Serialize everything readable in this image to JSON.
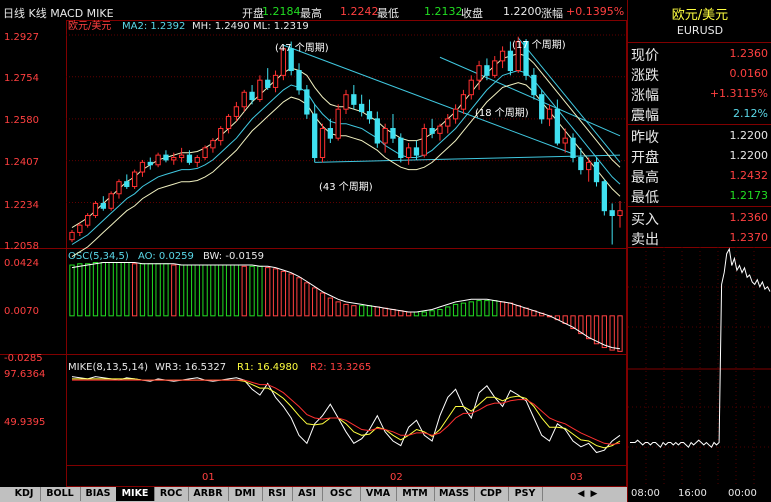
{
  "topbar": {
    "title": "日线 K线 MACD MIKE",
    "open_label": "开盘",
    "open_value": "1.2184",
    "high_label": "最高",
    "high_value": "1.2242",
    "low_label": "最低",
    "low_value": "1.2132",
    "close_label": "收盘",
    "close_value": "1.2200",
    "change_label": "涨幅",
    "change_value": "+0.1395%"
  },
  "main_pane": {
    "title": "欧元/美元",
    "ma2": "MA2: 1.2392",
    "mh": "MH: 1.2490",
    "ml": "ML: 1.2319",
    "y_ticks": [
      "1.2927",
      "1.2754",
      "1.2580",
      "1.2407",
      "1.2234",
      "1.2058"
    ],
    "annotations": [
      "(47 个周期)",
      "(17 个周期)",
      "(18 个周期)",
      "(43 个周期)"
    ]
  },
  "osc_pane": {
    "title": "OSC(5,34,5)",
    "ao": "AO: 0.0259",
    "bw": "BW: -0.0159",
    "y_ticks": [
      "0.0424",
      "0.0070",
      "-0.0285"
    ]
  },
  "mike_pane": {
    "title": "MIKE(8,13,5,14)",
    "wr3": "WR3: 16.5327",
    "r1": "R1: 16.4980",
    "r2": "R2: 13.3265",
    "y_ticks": [
      "97.6364",
      "49.9395"
    ]
  },
  "x_axis": {
    "labels": [
      "01",
      "02",
      "03"
    ]
  },
  "tabs": {
    "items": [
      "KDJ",
      "BOLL",
      "BIAS",
      "MIKE",
      "ROC",
      "ARBR",
      "DMI",
      "RSI",
      "ASI",
      "OSC",
      "VMA",
      "MTM",
      "MASS",
      "CDP",
      "PSY"
    ],
    "active": "MIKE"
  },
  "panel": {
    "name": "欧元/美元",
    "code": "EURUSD",
    "quotes": [
      {
        "label": "现价",
        "value": "1.2360",
        "color": "#ff4040"
      },
      {
        "label": "涨跌",
        "value": "0.0160",
        "color": "#ff4040"
      },
      {
        "label": "涨幅",
        "value": "+1.3115%",
        "color": "#ff4040"
      },
      {
        "label": "震幅",
        "value": "2.12%",
        "color": "#5ad8e8"
      },
      {
        "label": "昨收",
        "value": "1.2200",
        "color": "#e8e8e8"
      },
      {
        "label": "开盘",
        "value": "1.2200",
        "color": "#e8e8e8"
      },
      {
        "label": "最高",
        "value": "1.2432",
        "color": "#ff4040"
      },
      {
        "label": "最低",
        "value": "1.2173",
        "color": "#22dd22"
      },
      {
        "label": "买入",
        "value": "1.2360",
        "color": "#ff4040"
      },
      {
        "label": "卖出",
        "value": "1.2370",
        "color": "#ff4040"
      }
    ],
    "time_labels": [
      "08:00",
      "16:00",
      "00:00"
    ]
  },
  "colors": {
    "up": "#ff3030",
    "down": "#40e0f0",
    "grid": "#800000",
    "osc_up": "#22dd22",
    "osc_down": "#ff4040"
  },
  "chart_data": [
    {
      "type": "candlestick",
      "title": "欧元/美元",
      "ylim": [
        1.2058,
        1.2927
      ],
      "x_labels": [
        "01",
        "02",
        "03"
      ],
      "ohlc": [
        [
          1.208,
          1.212,
          1.207,
          1.211
        ],
        [
          1.211,
          1.215,
          1.2095,
          1.214
        ],
        [
          1.214,
          1.219,
          1.213,
          1.218
        ],
        [
          1.218,
          1.224,
          1.217,
          1.223
        ],
        [
          1.223,
          1.226,
          1.22,
          1.221
        ],
        [
          1.221,
          1.228,
          1.22,
          1.227
        ],
        [
          1.227,
          1.233,
          1.225,
          1.232
        ],
        [
          1.232,
          1.235,
          1.229,
          1.23
        ],
        [
          1.23,
          1.237,
          1.229,
          1.236
        ],
        [
          1.236,
          1.241,
          1.234,
          1.24
        ],
        [
          1.24,
          1.242,
          1.237,
          1.239
        ],
        [
          1.239,
          1.244,
          1.238,
          1.243
        ],
        [
          1.243,
          1.245,
          1.24,
          1.241
        ],
        [
          1.241,
          1.244,
          1.239,
          1.242
        ],
        [
          1.242,
          1.246,
          1.24,
          1.243
        ],
        [
          1.243,
          1.245,
          1.239,
          1.24
        ],
        [
          1.24,
          1.243,
          1.238,
          1.242
        ],
        [
          1.242,
          1.247,
          1.241,
          1.246
        ],
        [
          1.246,
          1.25,
          1.244,
          1.249
        ],
        [
          1.249,
          1.255,
          1.247,
          1.254
        ],
        [
          1.254,
          1.26,
          1.252,
          1.259
        ],
        [
          1.259,
          1.265,
          1.257,
          1.263
        ],
        [
          1.263,
          1.27,
          1.261,
          1.269
        ],
        [
          1.269,
          1.272,
          1.264,
          1.266
        ],
        [
          1.266,
          1.276,
          1.265,
          1.274
        ],
        [
          1.274,
          1.279,
          1.27,
          1.271
        ],
        [
          1.271,
          1.278,
          1.269,
          1.276
        ],
        [
          1.276,
          1.288,
          1.274,
          1.287
        ],
        [
          1.287,
          1.29,
          1.276,
          1.278
        ],
        [
          1.278,
          1.281,
          1.268,
          1.27
        ],
        [
          1.27,
          1.272,
          1.258,
          1.26
        ],
        [
          1.26,
          1.264,
          1.24,
          1.242
        ],
        [
          1.242,
          1.256,
          1.24,
          1.254
        ],
        [
          1.254,
          1.258,
          1.248,
          1.25
        ],
        [
          1.25,
          1.264,
          1.249,
          1.262
        ],
        [
          1.262,
          1.27,
          1.26,
          1.268
        ],
        [
          1.268,
          1.272,
          1.262,
          1.264
        ],
        [
          1.264,
          1.268,
          1.259,
          1.261
        ],
        [
          1.261,
          1.266,
          1.256,
          1.258
        ],
        [
          1.258,
          1.261,
          1.246,
          1.248
        ],
        [
          1.248,
          1.256,
          1.244,
          1.254
        ],
        [
          1.254,
          1.26,
          1.248,
          1.25
        ],
        [
          1.25,
          1.252,
          1.24,
          1.242
        ],
        [
          1.242,
          1.248,
          1.239,
          1.246
        ],
        [
          1.246,
          1.249,
          1.241,
          1.243
        ],
        [
          1.243,
          1.256,
          1.242,
          1.254
        ],
        [
          1.254,
          1.258,
          1.25,
          1.252
        ],
        [
          1.252,
          1.256,
          1.249,
          1.255
        ],
        [
          1.255,
          1.26,
          1.252,
          1.258
        ],
        [
          1.258,
          1.264,
          1.256,
          1.262
        ],
        [
          1.262,
          1.27,
          1.26,
          1.268
        ],
        [
          1.268,
          1.276,
          1.266,
          1.274
        ],
        [
          1.274,
          1.282,
          1.27,
          1.28
        ],
        [
          1.28,
          1.283,
          1.274,
          1.276
        ],
        [
          1.276,
          1.284,
          1.275,
          1.282
        ],
        [
          1.282,
          1.288,
          1.279,
          1.286
        ],
        [
          1.286,
          1.29,
          1.276,
          1.278
        ],
        [
          1.278,
          1.292,
          1.277,
          1.29
        ],
        [
          1.29,
          1.291,
          1.274,
          1.276
        ],
        [
          1.276,
          1.279,
          1.266,
          1.268
        ],
        [
          1.268,
          1.27,
          1.256,
          1.258
        ],
        [
          1.258,
          1.264,
          1.255,
          1.262
        ],
        [
          1.262,
          1.266,
          1.247,
          1.248
        ],
        [
          1.248,
          1.254,
          1.244,
          1.25
        ],
        [
          1.25,
          1.252,
          1.24,
          1.242
        ],
        [
          1.242,
          1.246,
          1.235,
          1.237
        ],
        [
          1.237,
          1.242,
          1.232,
          1.24
        ],
        [
          1.24,
          1.242,
          1.23,
          1.232
        ],
        [
          1.232,
          1.233,
          1.218,
          1.22
        ],
        [
          1.22,
          1.223,
          1.206,
          1.218
        ],
        [
          1.218,
          1.224,
          1.213,
          1.22
        ]
      ],
      "ma2": [
        1.206,
        1.208,
        1.21,
        1.213,
        1.216,
        1.219,
        1.222,
        1.225,
        1.227,
        1.23,
        1.232,
        1.234,
        1.235,
        1.236,
        1.237,
        1.237,
        1.2375,
        1.239,
        1.241,
        1.244,
        1.247,
        1.25,
        1.254,
        1.258,
        1.261,
        1.264,
        1.267,
        1.27,
        1.272,
        1.271,
        1.269,
        1.264,
        1.26,
        1.257,
        1.256,
        1.256,
        1.255,
        1.254,
        1.252,
        1.25,
        1.247,
        1.245,
        1.243,
        1.242,
        1.242,
        1.243,
        1.245,
        1.248,
        1.251,
        1.254,
        1.258,
        1.262,
        1.266,
        1.27,
        1.273,
        1.276,
        1.277,
        1.278,
        1.277,
        1.274,
        1.27,
        1.266,
        1.262,
        1.258,
        1.254,
        1.25,
        1.246,
        1.242,
        1.238,
        1.234,
        1.231
      ],
      "mh": [
        1.213,
        1.215,
        1.217,
        1.22,
        1.223,
        1.226,
        1.229,
        1.232,
        1.234,
        1.237,
        1.239,
        1.241,
        1.242,
        1.243,
        1.244,
        1.244,
        1.2445,
        1.246,
        1.248,
        1.251,
        1.254,
        1.257,
        1.261,
        1.265,
        1.268,
        1.271,
        1.274,
        1.277,
        1.279,
        1.278,
        1.276,
        1.271,
        1.267,
        1.264,
        1.263,
        1.263,
        1.262,
        1.261,
        1.259,
        1.257,
        1.254,
        1.252,
        1.25,
        1.249,
        1.249,
        1.25,
        1.252,
        1.255,
        1.258,
        1.261,
        1.265,
        1.269,
        1.273,
        1.277,
        1.28,
        1.283,
        1.284,
        1.285,
        1.284,
        1.281,
        1.277,
        1.273,
        1.269,
        1.265,
        1.261,
        1.257,
        1.253,
        1.249,
        1.245,
        1.241,
        1.238
      ],
      "ml": [
        1.201,
        1.203,
        1.205,
        1.208,
        1.211,
        1.214,
        1.217,
        1.22,
        1.222,
        1.225,
        1.227,
        1.229,
        1.23,
        1.231,
        1.232,
        1.232,
        1.2325,
        1.234,
        1.236,
        1.239,
        1.242,
        1.245,
        1.249,
        1.253,
        1.256,
        1.259,
        1.262,
        1.265,
        1.267,
        1.266,
        1.264,
        1.259,
        1.255,
        1.252,
        1.251,
        1.251,
        1.25,
        1.249,
        1.247,
        1.245,
        1.242,
        1.24,
        1.238,
        1.237,
        1.237,
        1.238,
        1.24,
        1.243,
        1.246,
        1.249,
        1.253,
        1.257,
        1.261,
        1.265,
        1.268,
        1.271,
        1.272,
        1.273,
        1.272,
        1.269,
        1.265,
        1.261,
        1.257,
        1.253,
        1.249,
        1.245,
        1.241,
        1.237,
        1.233,
        1.229,
        1.226
      ]
    },
    {
      "type": "bar",
      "title": "OSC(5,34,5)",
      "ylim": [
        -0.0285,
        0.0424
      ],
      "values": [
        0.04,
        0.041,
        0.041,
        0.042,
        0.042,
        0.042,
        0.042,
        0.042,
        0.041,
        0.041,
        0.041,
        0.041,
        0.041,
        0.04,
        0.04,
        0.04,
        0.04,
        0.04,
        0.04,
        0.04,
        0.04,
        0.04,
        0.039,
        0.039,
        0.039,
        0.038,
        0.037,
        0.035,
        0.033,
        0.03,
        0.026,
        0.022,
        0.018,
        0.014,
        0.011,
        0.009,
        0.008,
        0.008,
        0.008,
        0.007,
        0.006,
        0.005,
        0.004,
        0.003,
        0.003,
        0.003,
        0.004,
        0.005,
        0.007,
        0.009,
        0.01,
        0.011,
        0.012,
        0.012,
        0.012,
        0.011,
        0.01,
        0.008,
        0.006,
        0.004,
        0.002,
        0.0,
        -0.003,
        -0.006,
        -0.01,
        -0.014,
        -0.018,
        -0.022,
        -0.025,
        -0.027,
        -0.028
      ],
      "ao_line": [
        0.038,
        0.039,
        0.04,
        0.041,
        0.042,
        0.042,
        0.042,
        0.042,
        0.042,
        0.041,
        0.041,
        0.041,
        0.041,
        0.041,
        0.04,
        0.04,
        0.04,
        0.04,
        0.04,
        0.04,
        0.04,
        0.04,
        0.04,
        0.04,
        0.039,
        0.039,
        0.038,
        0.036,
        0.034,
        0.031,
        0.027,
        0.023,
        0.019,
        0.016,
        0.013,
        0.011,
        0.01,
        0.009,
        0.008,
        0.007,
        0.006,
        0.005,
        0.004,
        0.003,
        0.003,
        0.004,
        0.005,
        0.007,
        0.009,
        0.011,
        0.012,
        0.013,
        0.013,
        0.013,
        0.012,
        0.011,
        0.01,
        0.008,
        0.006,
        0.004,
        0.002,
        0.0,
        -0.003,
        -0.006,
        -0.009,
        -0.013,
        -0.017,
        -0.02,
        -0.023,
        -0.025,
        -0.026
      ]
    },
    {
      "type": "line",
      "title": "MIKE(8,13,5,14)",
      "ylim": [
        20,
        100
      ],
      "series": [
        {
          "name": "WR3",
          "values": [
            96,
            95,
            94,
            96,
            95,
            94,
            93,
            95,
            94,
            93,
            92,
            94,
            93,
            92,
            93,
            94,
            95,
            93,
            92,
            93,
            94,
            95,
            93,
            85,
            80,
            90,
            78,
            70,
            60,
            45,
            38,
            55,
            62,
            72,
            60,
            48,
            38,
            42,
            50,
            62,
            48,
            40,
            36,
            52,
            58,
            45,
            40,
            62,
            78,
            85,
            70,
            60,
            82,
            88,
            78,
            70,
            84,
            80,
            75,
            60,
            45,
            40,
            55,
            50,
            40,
            35,
            38,
            30,
            32,
            40,
            45
          ]
        },
        {
          "name": "R1",
          "values": [
            94,
            94,
            94,
            94,
            94,
            94,
            94,
            94,
            94,
            93,
            93,
            93,
            93,
            93,
            93,
            93,
            93,
            93,
            93,
            93,
            93,
            93,
            92,
            89,
            86,
            86,
            82,
            77,
            70,
            62,
            55,
            54,
            55,
            60,
            60,
            55,
            48,
            45,
            46,
            52,
            50,
            45,
            41,
            45,
            50,
            48,
            44,
            50,
            60,
            70,
            70,
            66,
            72,
            78,
            78,
            75,
            78,
            79,
            77,
            70,
            60,
            52,
            52,
            51,
            46,
            41,
            40,
            36,
            34,
            36,
            40
          ]
        },
        {
          "name": "R2",
          "values": [
            93,
            93,
            93,
            93,
            93,
            93,
            93,
            93,
            93,
            93,
            93,
            93,
            93,
            93,
            93,
            93,
            93,
            93,
            93,
            93,
            93,
            93,
            93,
            91,
            89,
            89,
            86,
            82,
            76,
            70,
            63,
            60,
            59,
            60,
            60,
            58,
            54,
            50,
            49,
            51,
            50,
            48,
            45,
            45,
            47,
            47,
            45,
            47,
            53,
            60,
            64,
            64,
            67,
            71,
            73,
            73,
            75,
            76,
            76,
            72,
            66,
            60,
            57,
            55,
            51,
            47,
            44,
            41,
            38,
            37,
            38
          ]
        }
      ]
    }
  ],
  "minichart": {
    "values": [
      0.18,
      0.18,
      0.18,
      0.19,
      0.18,
      0.17,
      0.18,
      0.18,
      0.17,
      0.18,
      0.18,
      0.17,
      0.16,
      0.18,
      0.17,
      0.18,
      0.18,
      0.17,
      0.18,
      0.17,
      0.18,
      0.18,
      0.17,
      0.16,
      0.18,
      0.17,
      0.18,
      0.19,
      0.18,
      0.17,
      0.18,
      0.17,
      0.16,
      0.18,
      0.17,
      0.18,
      0.85,
      0.9,
      0.98,
      1.0,
      0.93,
      0.96,
      0.91,
      0.93,
      0.9,
      0.92,
      0.88,
      0.89,
      0.86,
      0.85,
      0.87,
      0.84,
      0.86,
      0.83,
      0.84,
      0.82
    ]
  }
}
